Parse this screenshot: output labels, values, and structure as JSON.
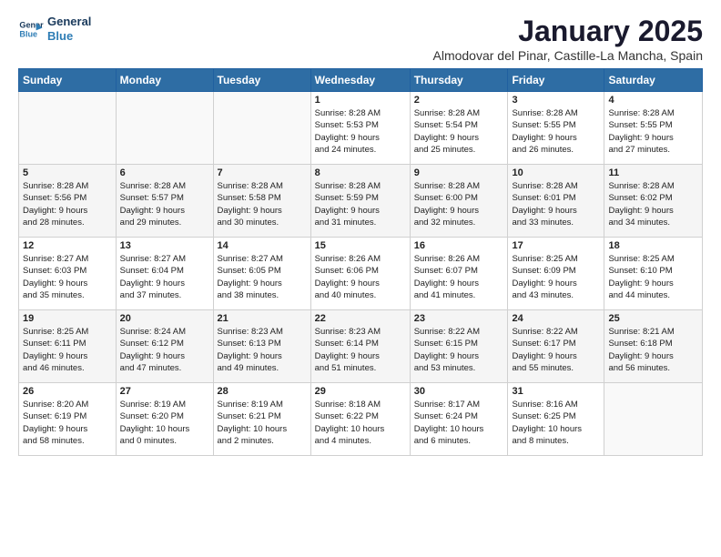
{
  "logo": {
    "line1": "General",
    "line2": "Blue"
  },
  "title": "January 2025",
  "subtitle": "Almodovar del Pinar, Castille-La Mancha, Spain",
  "days_of_week": [
    "Sunday",
    "Monday",
    "Tuesday",
    "Wednesday",
    "Thursday",
    "Friday",
    "Saturday"
  ],
  "weeks": [
    [
      {
        "day": "",
        "info": ""
      },
      {
        "day": "",
        "info": ""
      },
      {
        "day": "",
        "info": ""
      },
      {
        "day": "1",
        "info": "Sunrise: 8:28 AM\nSunset: 5:53 PM\nDaylight: 9 hours\nand 24 minutes."
      },
      {
        "day": "2",
        "info": "Sunrise: 8:28 AM\nSunset: 5:54 PM\nDaylight: 9 hours\nand 25 minutes."
      },
      {
        "day": "3",
        "info": "Sunrise: 8:28 AM\nSunset: 5:55 PM\nDaylight: 9 hours\nand 26 minutes."
      },
      {
        "day": "4",
        "info": "Sunrise: 8:28 AM\nSunset: 5:55 PM\nDaylight: 9 hours\nand 27 minutes."
      }
    ],
    [
      {
        "day": "5",
        "info": "Sunrise: 8:28 AM\nSunset: 5:56 PM\nDaylight: 9 hours\nand 28 minutes."
      },
      {
        "day": "6",
        "info": "Sunrise: 8:28 AM\nSunset: 5:57 PM\nDaylight: 9 hours\nand 29 minutes."
      },
      {
        "day": "7",
        "info": "Sunrise: 8:28 AM\nSunset: 5:58 PM\nDaylight: 9 hours\nand 30 minutes."
      },
      {
        "day": "8",
        "info": "Sunrise: 8:28 AM\nSunset: 5:59 PM\nDaylight: 9 hours\nand 31 minutes."
      },
      {
        "day": "9",
        "info": "Sunrise: 8:28 AM\nSunset: 6:00 PM\nDaylight: 9 hours\nand 32 minutes."
      },
      {
        "day": "10",
        "info": "Sunrise: 8:28 AM\nSunset: 6:01 PM\nDaylight: 9 hours\nand 33 minutes."
      },
      {
        "day": "11",
        "info": "Sunrise: 8:28 AM\nSunset: 6:02 PM\nDaylight: 9 hours\nand 34 minutes."
      }
    ],
    [
      {
        "day": "12",
        "info": "Sunrise: 8:27 AM\nSunset: 6:03 PM\nDaylight: 9 hours\nand 35 minutes."
      },
      {
        "day": "13",
        "info": "Sunrise: 8:27 AM\nSunset: 6:04 PM\nDaylight: 9 hours\nand 37 minutes."
      },
      {
        "day": "14",
        "info": "Sunrise: 8:27 AM\nSunset: 6:05 PM\nDaylight: 9 hours\nand 38 minutes."
      },
      {
        "day": "15",
        "info": "Sunrise: 8:26 AM\nSunset: 6:06 PM\nDaylight: 9 hours\nand 40 minutes."
      },
      {
        "day": "16",
        "info": "Sunrise: 8:26 AM\nSunset: 6:07 PM\nDaylight: 9 hours\nand 41 minutes."
      },
      {
        "day": "17",
        "info": "Sunrise: 8:25 AM\nSunset: 6:09 PM\nDaylight: 9 hours\nand 43 minutes."
      },
      {
        "day": "18",
        "info": "Sunrise: 8:25 AM\nSunset: 6:10 PM\nDaylight: 9 hours\nand 44 minutes."
      }
    ],
    [
      {
        "day": "19",
        "info": "Sunrise: 8:25 AM\nSunset: 6:11 PM\nDaylight: 9 hours\nand 46 minutes."
      },
      {
        "day": "20",
        "info": "Sunrise: 8:24 AM\nSunset: 6:12 PM\nDaylight: 9 hours\nand 47 minutes."
      },
      {
        "day": "21",
        "info": "Sunrise: 8:23 AM\nSunset: 6:13 PM\nDaylight: 9 hours\nand 49 minutes."
      },
      {
        "day": "22",
        "info": "Sunrise: 8:23 AM\nSunset: 6:14 PM\nDaylight: 9 hours\nand 51 minutes."
      },
      {
        "day": "23",
        "info": "Sunrise: 8:22 AM\nSunset: 6:15 PM\nDaylight: 9 hours\nand 53 minutes."
      },
      {
        "day": "24",
        "info": "Sunrise: 8:22 AM\nSunset: 6:17 PM\nDaylight: 9 hours\nand 55 minutes."
      },
      {
        "day": "25",
        "info": "Sunrise: 8:21 AM\nSunset: 6:18 PM\nDaylight: 9 hours\nand 56 minutes."
      }
    ],
    [
      {
        "day": "26",
        "info": "Sunrise: 8:20 AM\nSunset: 6:19 PM\nDaylight: 9 hours\nand 58 minutes."
      },
      {
        "day": "27",
        "info": "Sunrise: 8:19 AM\nSunset: 6:20 PM\nDaylight: 10 hours\nand 0 minutes."
      },
      {
        "day": "28",
        "info": "Sunrise: 8:19 AM\nSunset: 6:21 PM\nDaylight: 10 hours\nand 2 minutes."
      },
      {
        "day": "29",
        "info": "Sunrise: 8:18 AM\nSunset: 6:22 PM\nDaylight: 10 hours\nand 4 minutes."
      },
      {
        "day": "30",
        "info": "Sunrise: 8:17 AM\nSunset: 6:24 PM\nDaylight: 10 hours\nand 6 minutes."
      },
      {
        "day": "31",
        "info": "Sunrise: 8:16 AM\nSunset: 6:25 PM\nDaylight: 10 hours\nand 8 minutes."
      },
      {
        "day": "",
        "info": ""
      }
    ]
  ]
}
